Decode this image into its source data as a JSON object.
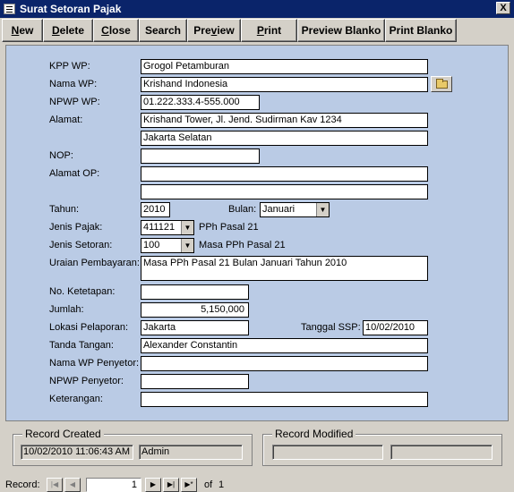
{
  "window": {
    "title": "Surat Setoran Pajak",
    "close_glyph": "X"
  },
  "toolbar": {
    "new": {
      "mn": "N",
      "rest": "ew"
    },
    "delete": {
      "mn": "D",
      "rest": "elete"
    },
    "close": {
      "mn": "C",
      "rest": "lose"
    },
    "search": "Search",
    "preview": {
      "pre": "Pre",
      "mn": "v",
      "rest": "iew"
    },
    "print": {
      "mn": "P",
      "rest": "rint"
    },
    "preview_blanko": "Preview Blanko",
    "print_blanko": "Print Blanko"
  },
  "form": {
    "kpp_wp": {
      "label": "KPP WP:",
      "value": "Grogol Petamburan"
    },
    "nama_wp": {
      "label": "Nama WP:",
      "value": "Krishand Indonesia"
    },
    "npwp_wp": {
      "label": "NPWP WP:",
      "value": "01.222.333.4-555.000"
    },
    "alamat": {
      "label": "Alamat:",
      "line1": "Krishand Tower, Jl. Jend. Sudirman Kav 1234",
      "line2": "Jakarta Selatan"
    },
    "nop": {
      "label": "NOP:",
      "value": ""
    },
    "alamat_op": {
      "label": "Alamat OP:",
      "line1": "",
      "line2": ""
    },
    "tahun": {
      "label": "Tahun:",
      "value": "2010"
    },
    "bulan": {
      "label": "Bulan:",
      "value": "Januari"
    },
    "jenis_pajak": {
      "label": "Jenis Pajak:",
      "value": "411121",
      "desc": "PPh Pasal 21"
    },
    "jenis_setoran": {
      "label": "Jenis Setoran:",
      "value": "100",
      "desc": "Masa PPh Pasal 21"
    },
    "uraian": {
      "label": "Uraian Pembayaran:",
      "value": "Masa PPh Pasal 21 Bulan Januari Tahun 2010"
    },
    "no_ketetapan": {
      "label": "No. Ketetapan:",
      "value": ""
    },
    "jumlah": {
      "label": "Jumlah:",
      "value": "5,150,000"
    },
    "lokasi": {
      "label": "Lokasi Pelaporan:",
      "value": "Jakarta"
    },
    "tanggal_ssp": {
      "label": "Tanggal SSP:",
      "value": "10/02/2010"
    },
    "tanda_tangan": {
      "label": "Tanda Tangan:",
      "value": "Alexander Constantin"
    },
    "nama_penyetor": {
      "label": "Nama WP Penyetor:",
      "value": ""
    },
    "npwp_penyetor": {
      "label": "NPWP Penyetor:",
      "value": ""
    },
    "keterangan": {
      "label": "Keterangan:",
      "value": ""
    }
  },
  "record_created": {
    "title": "Record Created",
    "datetime": "10/02/2010 11:06:43 AM",
    "user": "Admin"
  },
  "record_modified": {
    "title": "Record Modified",
    "datetime": "",
    "user": ""
  },
  "navigation": {
    "label": "Record:",
    "first": "|◀",
    "prev": "◀",
    "current": "1",
    "next": "▶",
    "last": "▶|",
    "new": "▶*",
    "of_text": "of",
    "total": "1"
  },
  "icons": {
    "combo_arrow": "▼"
  }
}
